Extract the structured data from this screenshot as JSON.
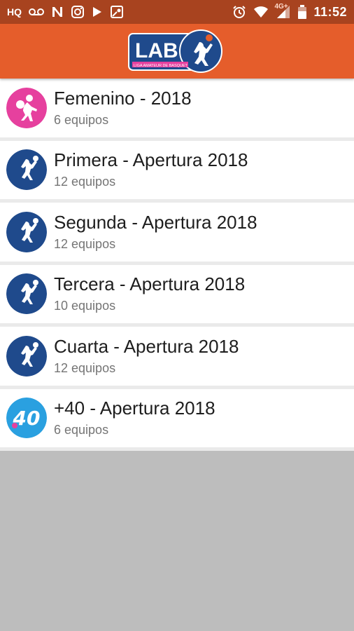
{
  "status_bar": {
    "time": "11:52",
    "network": "4G+",
    "left_icons": [
      "hq-icon",
      "voicemail-icon",
      "n-app-icon",
      "instagram-icon",
      "play-store-icon",
      "maps-icon"
    ],
    "right_icons": [
      "alarm-icon",
      "wifi-icon",
      "signal-icon",
      "battery-icon"
    ]
  },
  "header": {
    "logo_text": "LAB",
    "logo_subtitle": "LIGA AMATEUR DE BASQUET",
    "logo_colors": {
      "blue": "#1f4a8c",
      "orange": "#e55d2b",
      "pink": "#e6409e"
    }
  },
  "list": {
    "items": [
      {
        "title": "Femenino - 2018",
        "subtitle": "6 equipos",
        "icon": "female-player-icon",
        "icon_color": "#e6409e"
      },
      {
        "title": "Primera - Apertura 2018",
        "subtitle": "12 equipos",
        "icon": "basketball-player-icon",
        "icon_color": "#1f4a8c"
      },
      {
        "title": "Segunda - Apertura 2018",
        "subtitle": "12 equipos",
        "icon": "basketball-player-icon",
        "icon_color": "#1f4a8c"
      },
      {
        "title": "Tercera - Apertura 2018",
        "subtitle": "10 equipos",
        "icon": "basketball-player-icon",
        "icon_color": "#1f4a8c"
      },
      {
        "title": "Cuarta - Apertura 2018",
        "subtitle": "12 equipos",
        "icon": "basketball-player-icon",
        "icon_color": "#1f4a8c"
      },
      {
        "title": "+40 - Apertura 2018",
        "subtitle": "6 equipos",
        "icon": "forty-badge-icon",
        "icon_color": "#2aa0e0",
        "icon_text": "40"
      }
    ]
  }
}
